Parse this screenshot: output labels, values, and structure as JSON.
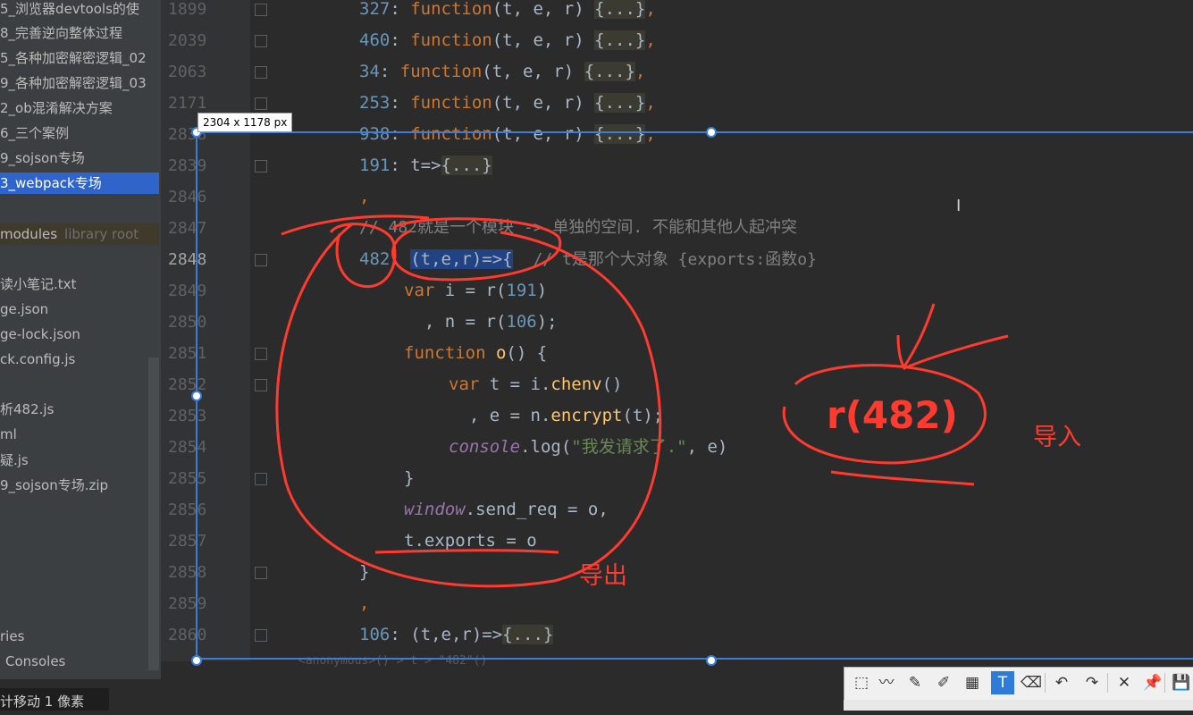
{
  "sidebar": {
    "items": [
      "5_浏览器devtools的使",
      "8_完善逆向整体过程",
      "5_各种加密解密逻辑_02",
      "9_各种加密解密逻辑_03",
      "2_ob混淆解决方案",
      "6_三个案例",
      "9_sojson专场",
      "3_webpack专场"
    ],
    "modules_label": "modules",
    "modules_note": "library root",
    "files": [
      "读小笔记.txt",
      "ge.json",
      "ge-lock.json",
      "ck.config.js",
      "析482.js",
      "ml",
      "疑.js",
      "9_sojson专场.zip"
    ],
    "bottom_items": [
      "ries",
      "Consoles"
    ]
  },
  "gutter": {
    "line_numbers": [
      "1899",
      "2039",
      "2063",
      "2171",
      "2838",
      "2839",
      "2846",
      "2847",
      "2848",
      "2849",
      "2850",
      "2851",
      "2852",
      "2853",
      "2854",
      "2855",
      "2856",
      "2857",
      "2858",
      "2859",
      "2860"
    ]
  },
  "code": {
    "line1": [
      "327",
      "function",
      "(t, e, r) ",
      "{...}",
      ","
    ],
    "line2": [
      "460",
      "function",
      "(t, e, r) ",
      "{...}",
      ","
    ],
    "line3": [
      "34",
      "function",
      "(t, e, r) ",
      "{...}",
      ","
    ],
    "line4": [
      "253",
      "function",
      "(t, e, r) ",
      "{...}",
      ","
    ],
    "line5": [
      "938",
      "function",
      "(t, e, r) ",
      "{...}",
      ","
    ],
    "line6": [
      "191",
      "t=>",
      "{...}"
    ],
    "line7": ",",
    "line8": "// 482就是一个模块 -> 单独的空间. 不能和其他人起冲突",
    "line9": [
      "482",
      "(t,e,r)=>{",
      "// t是那个大对象 {exports:函数o}"
    ],
    "line10": [
      "var",
      " i = r(",
      "191",
      ")"
    ],
    "line11": [
      "  , n = r(",
      "106",
      ");"
    ],
    "line12": [
      "function",
      "o",
      "() {"
    ],
    "line13": [
      "var",
      " t = i.",
      "chenv",
      "()"
    ],
    "line14": [
      "  , e = n.",
      "encrypt",
      "(t);"
    ],
    "line15": [
      "console",
      ".log(",
      "\"我发请求了.\"",
      ", e)"
    ],
    "line16": "}",
    "line17": [
      "window",
      ".send_req = o,"
    ],
    "line18": "t.exports = o",
    "line19": "}",
    "line20": ",",
    "line21": [
      "106",
      "(t,e,r)=>",
      "{...}"
    ]
  },
  "status_tail": "<anonymous>() > t > \"482\"()",
  "capture": {
    "size_label": "2304 x 1178  px"
  },
  "annotations": {
    "import_call": "r(482)",
    "import_label": "导入",
    "export_label": "导出"
  },
  "status_bar": {
    "text": "计移动 1 像素"
  },
  "toolbar": {
    "tools": [
      "shape-icon",
      "polyline-icon",
      "pen-icon",
      "marker-icon",
      "mosaic-icon",
      "text-icon",
      "eraser-icon",
      "undo-icon",
      "redo-icon",
      "close-icon",
      "pin-icon",
      "save-icon"
    ],
    "glyphs": [
      "⬚",
      "〰",
      "✎",
      "✐",
      "▦",
      "T",
      "⌫",
      "↶",
      "↷",
      "✕",
      "📌",
      "💾"
    ],
    "active_index": 5
  },
  "colors": {
    "annotation": "#ff3b30",
    "selection": "#3b7dd8",
    "keyword": "#cc7832",
    "number": "#6897bb"
  }
}
